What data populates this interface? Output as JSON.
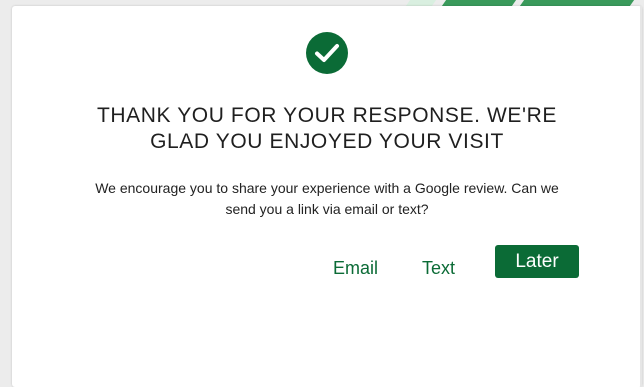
{
  "colors": {
    "accent": "#0b6b36",
    "text": "#1f1f1f",
    "background": "#ffffff"
  },
  "dialog": {
    "icon": "check-circle-icon",
    "title_lines": [
      "THANK YOU FOR YOUR RESPONSE. WE'RE",
      "GLAD YOU ENJOYED YOUR VISIT"
    ],
    "message_lines": [
      "We encourage you to share your experience with a Google review. Can we",
      "send you a link via email or text?"
    ],
    "buttons": {
      "email": "Email",
      "text": "Text",
      "later": "Later"
    }
  }
}
